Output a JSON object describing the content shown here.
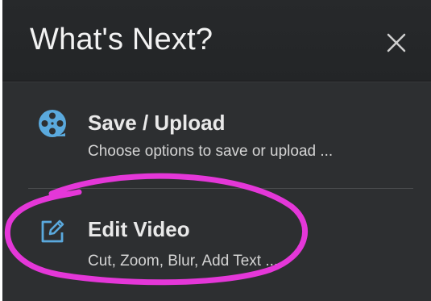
{
  "header": {
    "title": "What's Next?",
    "close_icon": "close-icon"
  },
  "menu": {
    "items": [
      {
        "icon": "film-reel-icon",
        "title": "Save / Upload",
        "description": "Choose options to save or upload ..."
      },
      {
        "icon": "edit-icon",
        "title": "Edit Video",
        "description": "Cut, Zoom, Blur, Add Text ..."
      }
    ]
  },
  "colors": {
    "panel_bg": "#2d2f31",
    "header_bg": "#242628",
    "accent_blue": "#5aa9dd",
    "annotation_magenta": "#e437d8",
    "text_primary": "#e9e9e9",
    "text_secondary": "#d4d4d4"
  }
}
